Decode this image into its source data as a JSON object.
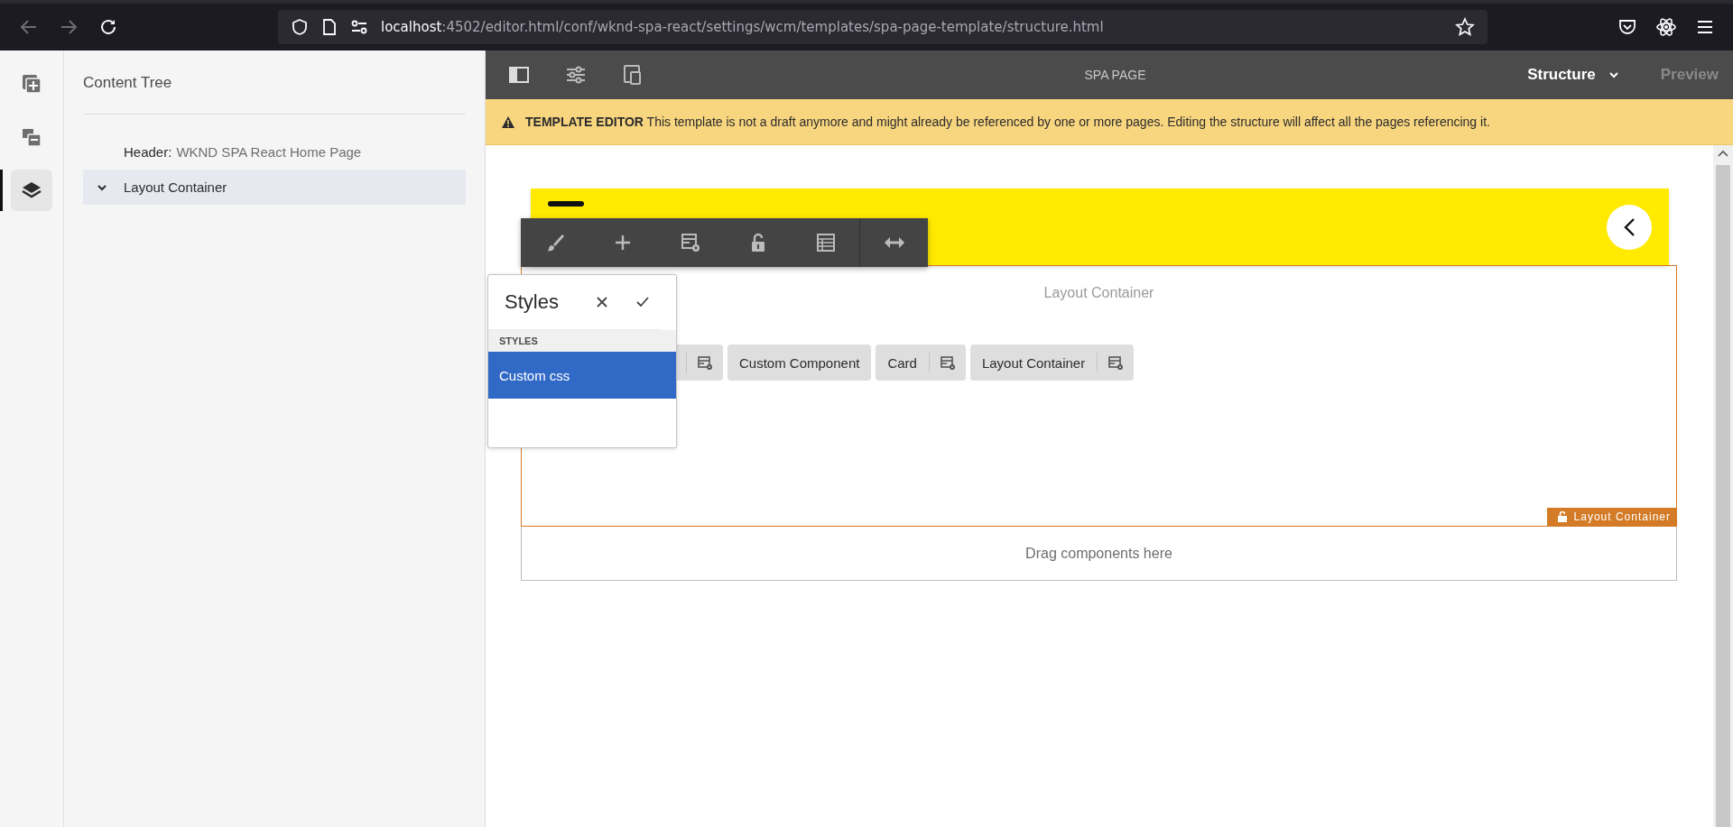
{
  "browser": {
    "url_host": "localhost",
    "url_path": ":4502/editor.html/conf/wknd-spa-react/settings/wcm/templates/spa-page-template/structure.html"
  },
  "side_rail": [
    {
      "kind": "components",
      "selected": false
    },
    {
      "kind": "assets",
      "selected": false
    },
    {
      "kind": "layers",
      "selected": true
    }
  ],
  "content_tree": {
    "title": "Content Tree",
    "items": [
      {
        "kind": "leaf",
        "label": "Header:",
        "value": "WKND SPA React Home Page",
        "selected": false
      },
      {
        "kind": "branch",
        "label": "Layout Container",
        "expanded": true,
        "selected": true
      }
    ]
  },
  "editor_toolbar": {
    "title": "SPA PAGE",
    "modes": [
      {
        "label": "Structure",
        "selected": true,
        "kind": "dropdown"
      },
      {
        "label": "Preview",
        "selected": false,
        "kind": "plain"
      }
    ]
  },
  "banner": {
    "text": "**TEMPLATE EDITOR** This template is not a draft anymore and might already be referenced by one or more pages. Editing the structure will affect all the pages referencing it."
  },
  "page": {
    "container_label": "Layout Container",
    "components": [
      {
        "kind": "policy"
      },
      {
        "kind": "plain",
        "label": "Custom Component"
      },
      {
        "kind": "policy",
        "label": "Card"
      },
      {
        "kind": "policy",
        "label": "Layout Container"
      }
    ],
    "container_tag": "Layout Container",
    "drop_zone": "Drag components here"
  },
  "styles_popup": {
    "title": "Styles",
    "section": "STYLES",
    "options": [
      {
        "label": "Custom css",
        "selected": true
      }
    ]
  }
}
